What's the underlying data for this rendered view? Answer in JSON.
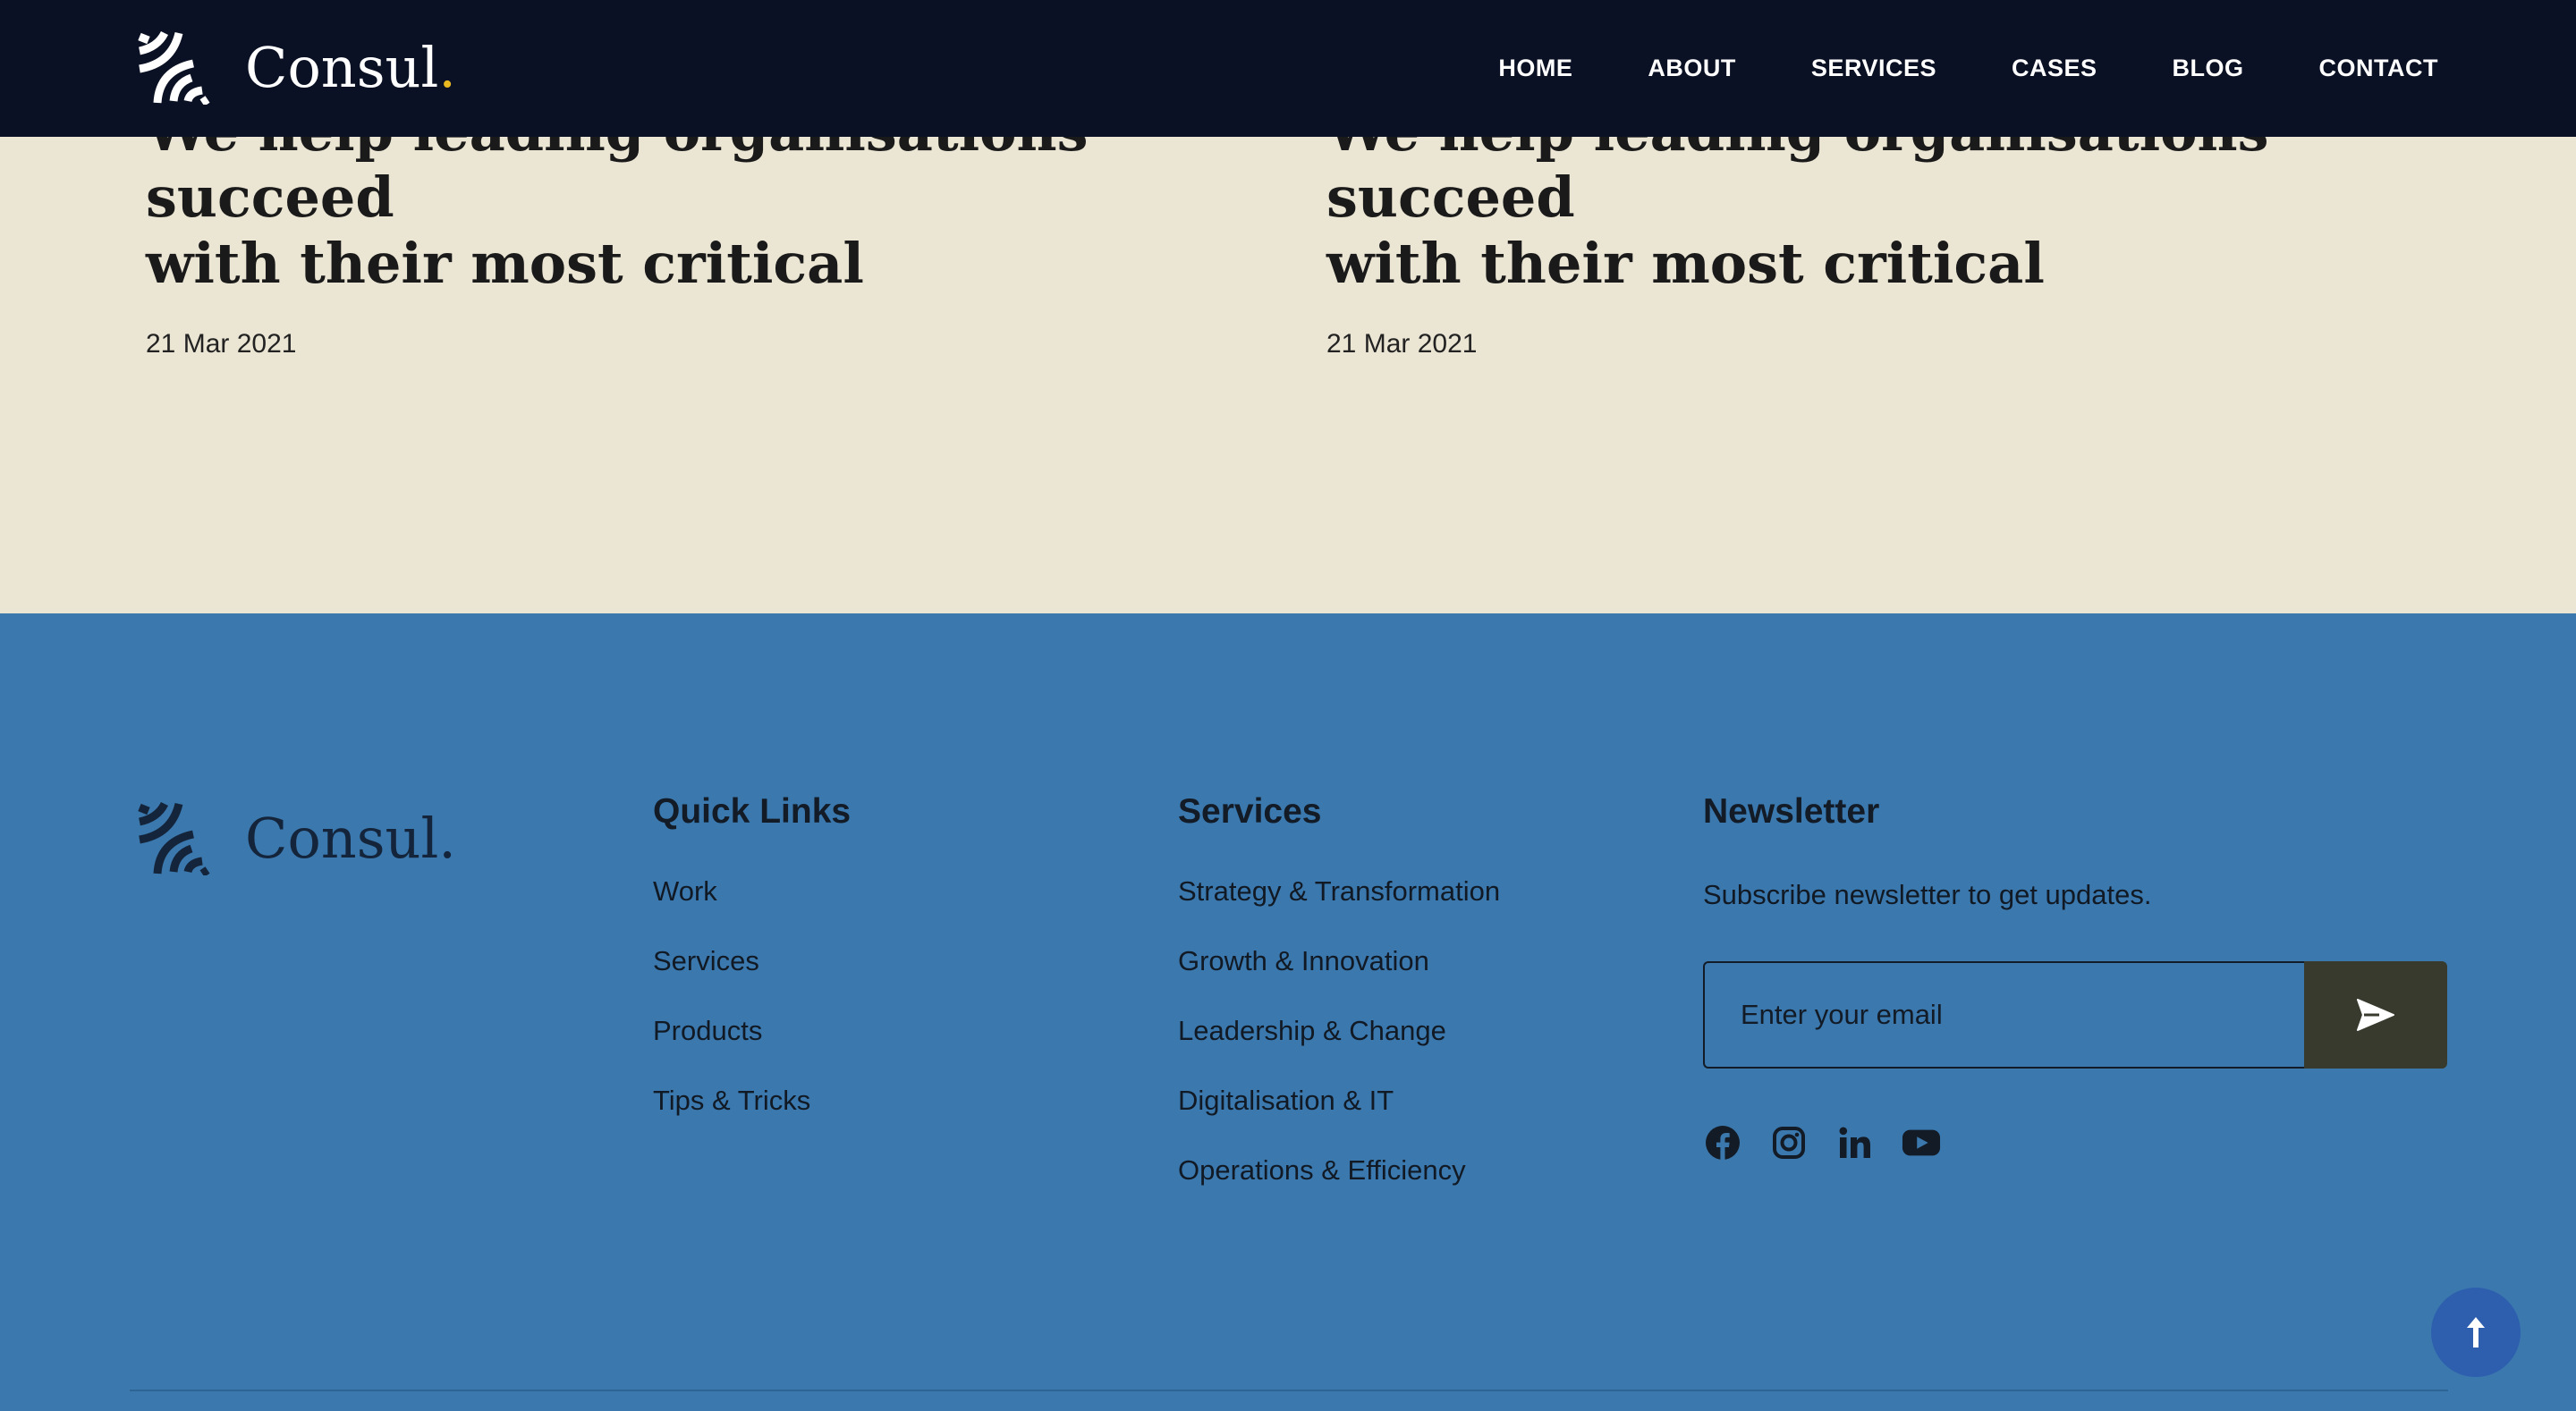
{
  "brand": {
    "name": "Consul",
    "dot": "."
  },
  "nav": {
    "items": [
      "HOME",
      "ABOUT",
      "SERVICES",
      "CASES",
      "BLOG",
      "CONTACT"
    ]
  },
  "posts": [
    {
      "title_line1": "We help leading organisations succeed",
      "title_line2": "with their most critical",
      "date": "21 Mar 2021"
    },
    {
      "title_line1": "We help leading organisations succeed",
      "title_line2": "with their most critical",
      "date": "21 Mar 2021"
    }
  ],
  "footer": {
    "quick_links": {
      "heading": "Quick Links",
      "items": [
        "Work",
        "Services",
        "Products",
        "Tips & Tricks"
      ]
    },
    "services": {
      "heading": "Services",
      "items": [
        "Strategy & Transformation",
        "Growth & Innovation",
        "Leadership & Change",
        "Digitalisation & IT",
        "Operations & Efficiency"
      ]
    },
    "newsletter": {
      "heading": "Newsletter",
      "text": "Subscribe newsletter to get updates.",
      "placeholder": "Enter your email"
    },
    "social": [
      "facebook-icon",
      "instagram-icon",
      "linkedin-icon",
      "youtube-icon"
    ]
  },
  "colors": {
    "nav_bg": "#0b1124",
    "blog_bg": "#ebe5d3",
    "footer_bg": "#3b78ae",
    "send_btn": "#373a2c",
    "accent_dot": "#e8b820",
    "to_top": "#2d5fae"
  }
}
